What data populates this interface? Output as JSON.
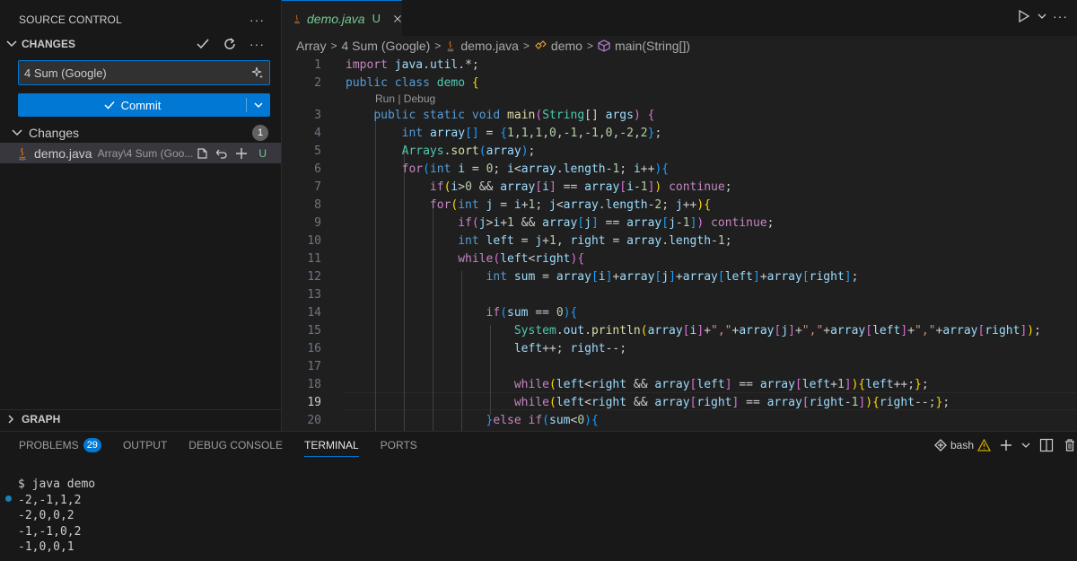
{
  "sidebar": {
    "title": "SOURCE CONTROL",
    "section_label": "CHANGES",
    "commit_message": "4 Sum (Google)",
    "commit_button": "Commit",
    "changes_label": "Changes",
    "changes_count": "1",
    "file": {
      "name": "demo.java",
      "path": "Array\\4 Sum (Goo...",
      "status": "U"
    },
    "graph_label": "GRAPH"
  },
  "editor": {
    "tab": {
      "name": "demo.java",
      "status": "U"
    },
    "breadcrumb": [
      "Array",
      "4 Sum (Google)",
      "demo.java",
      "demo",
      "main(String[])"
    ],
    "codelens": "Run | Debug",
    "active_line": 19,
    "line_numbers": [
      "1",
      "2",
      "3",
      "4",
      "5",
      "6",
      "7",
      "8",
      "9",
      "10",
      "11",
      "12",
      "13",
      "14",
      "15",
      "16",
      "17",
      "18",
      "19",
      "20"
    ]
  },
  "panel": {
    "tabs": [
      "PROBLEMS",
      "OUTPUT",
      "DEBUG CONSOLE",
      "TERMINAL",
      "PORTS"
    ],
    "problems_count": "29",
    "active_tab": "TERMINAL",
    "shell": "bash",
    "terminal_lines": [
      "$ java demo",
      "-2,-1,1,2",
      "-2,0,0,2",
      "-1,-1,0,2",
      "-1,0,0,1"
    ]
  },
  "colors": {
    "accent": "#0078d4",
    "untracked": "#73c991",
    "warning": "#cca700"
  },
  "icons": [
    "ellipsis-icon",
    "chevron-down-icon",
    "check-icon",
    "refresh-icon",
    "sparkle-icon",
    "java-file-icon",
    "open-file-icon",
    "discard-icon",
    "plus-icon",
    "close-icon",
    "run-icon",
    "symbol-class-icon",
    "symbol-method-icon",
    "terminal-icon",
    "warning-icon",
    "split-icon",
    "trash-icon"
  ]
}
